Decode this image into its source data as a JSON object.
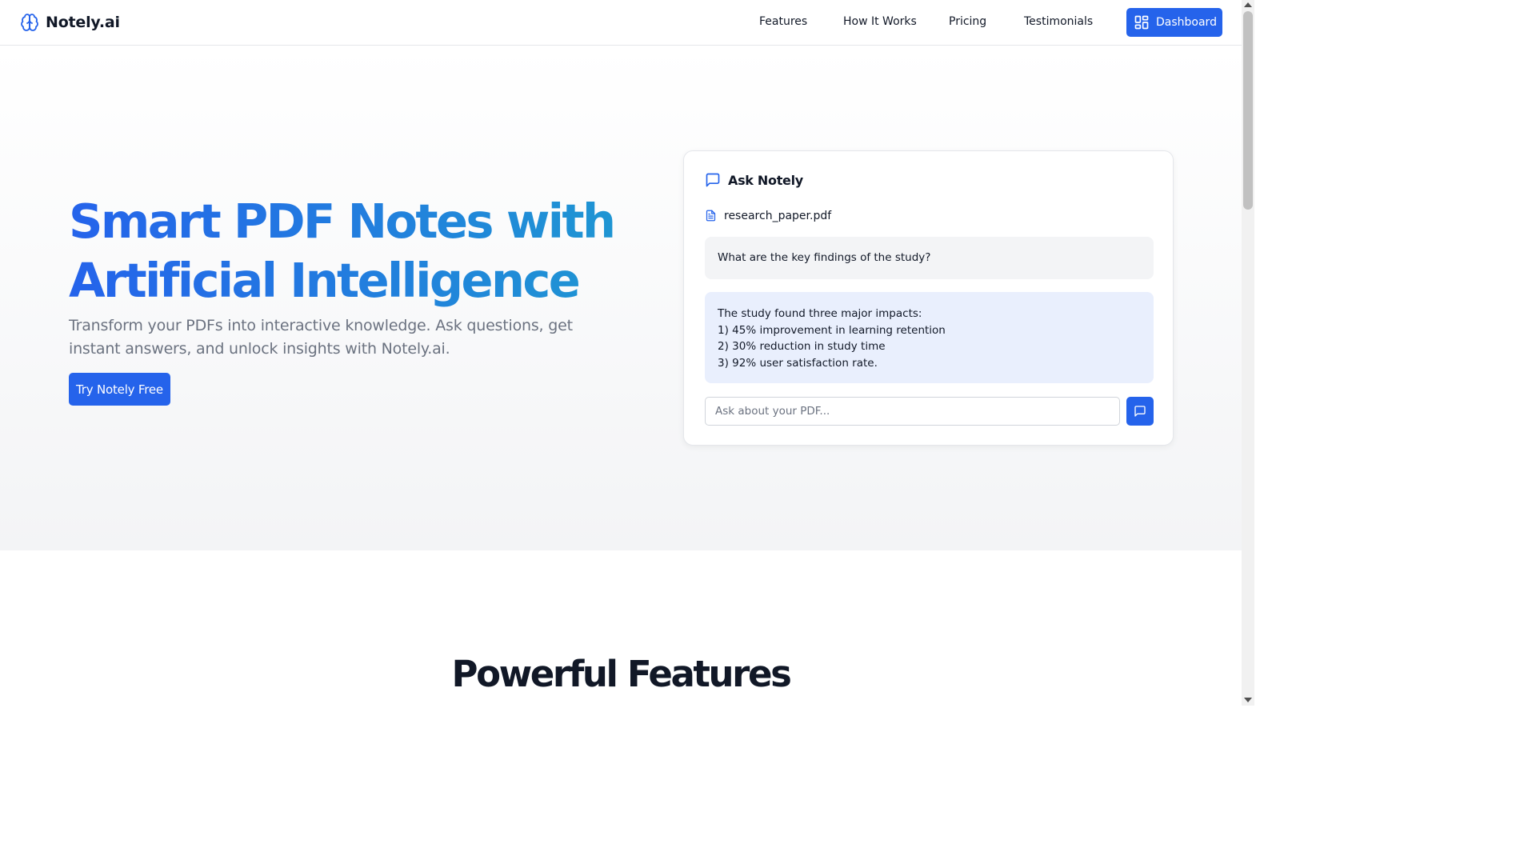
{
  "header": {
    "brand": "Notely.ai",
    "nav": [
      "Features",
      "How It Works",
      "Pricing",
      "Testimonials"
    ],
    "dashboard_label": "Dashboard"
  },
  "hero": {
    "title_line1": "Smart PDF Notes with",
    "title_line2": "Artificial Intelligence",
    "subtitle_line1": "Transform your PDFs into interactive knowledge. Ask questions, get",
    "subtitle_line2": "instant answers, and unlock insights with Notely.ai.",
    "cta_label": "Try Notely Free"
  },
  "chat": {
    "title": "Ask Notely",
    "file_name": "research_paper.pdf",
    "question": "What are the key findings of the study?",
    "answer_lines": [
      "The study found three major impacts:",
      "1) 45% improvement in learning retention",
      "2) 30% reduction in study time",
      "3) 92% user satisfaction rate."
    ],
    "input_placeholder": "Ask about your PDF..."
  },
  "features": {
    "title": "Powerful Features"
  },
  "colors": {
    "accent": "#2563eb",
    "gradient_end": "#1e9bd0",
    "answer_bg": "#e9effd",
    "question_bg": "#f3f4f6"
  },
  "icons": {
    "brand": "brain-icon",
    "dashboard": "grid-icon",
    "chat": "message-square-icon",
    "file": "file-text-icon",
    "send": "message-square-icon"
  }
}
